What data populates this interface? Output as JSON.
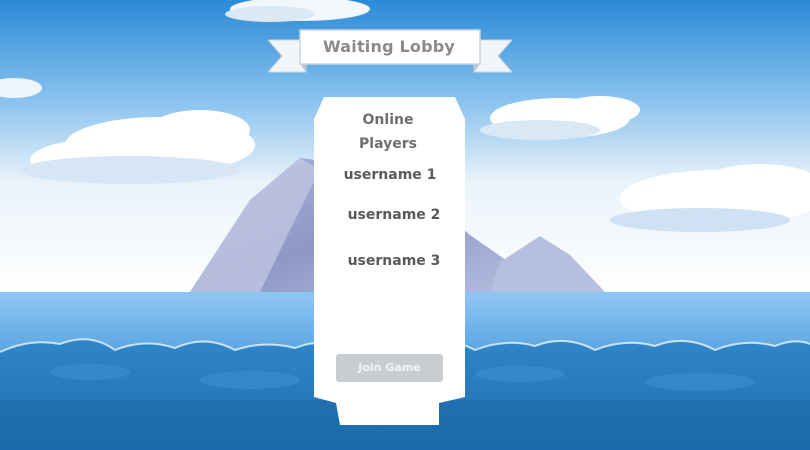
{
  "lobby": {
    "title": "Waiting Lobby"
  },
  "players_panel": {
    "heading_line1": "Online",
    "heading_line2": "Players",
    "players": [
      {
        "name": "username 1"
      },
      {
        "name": "username 2"
      },
      {
        "name": "username 3"
      }
    ],
    "join_label": "Join Game"
  },
  "colors": {
    "sky_top": "#2f8fd9",
    "sky_bottom": "#e8f2fb",
    "sea": "#2c7fc2",
    "panel": "#ffffff",
    "button": "#c9ccd0",
    "ribbon_text": "#8a8a8a"
  }
}
